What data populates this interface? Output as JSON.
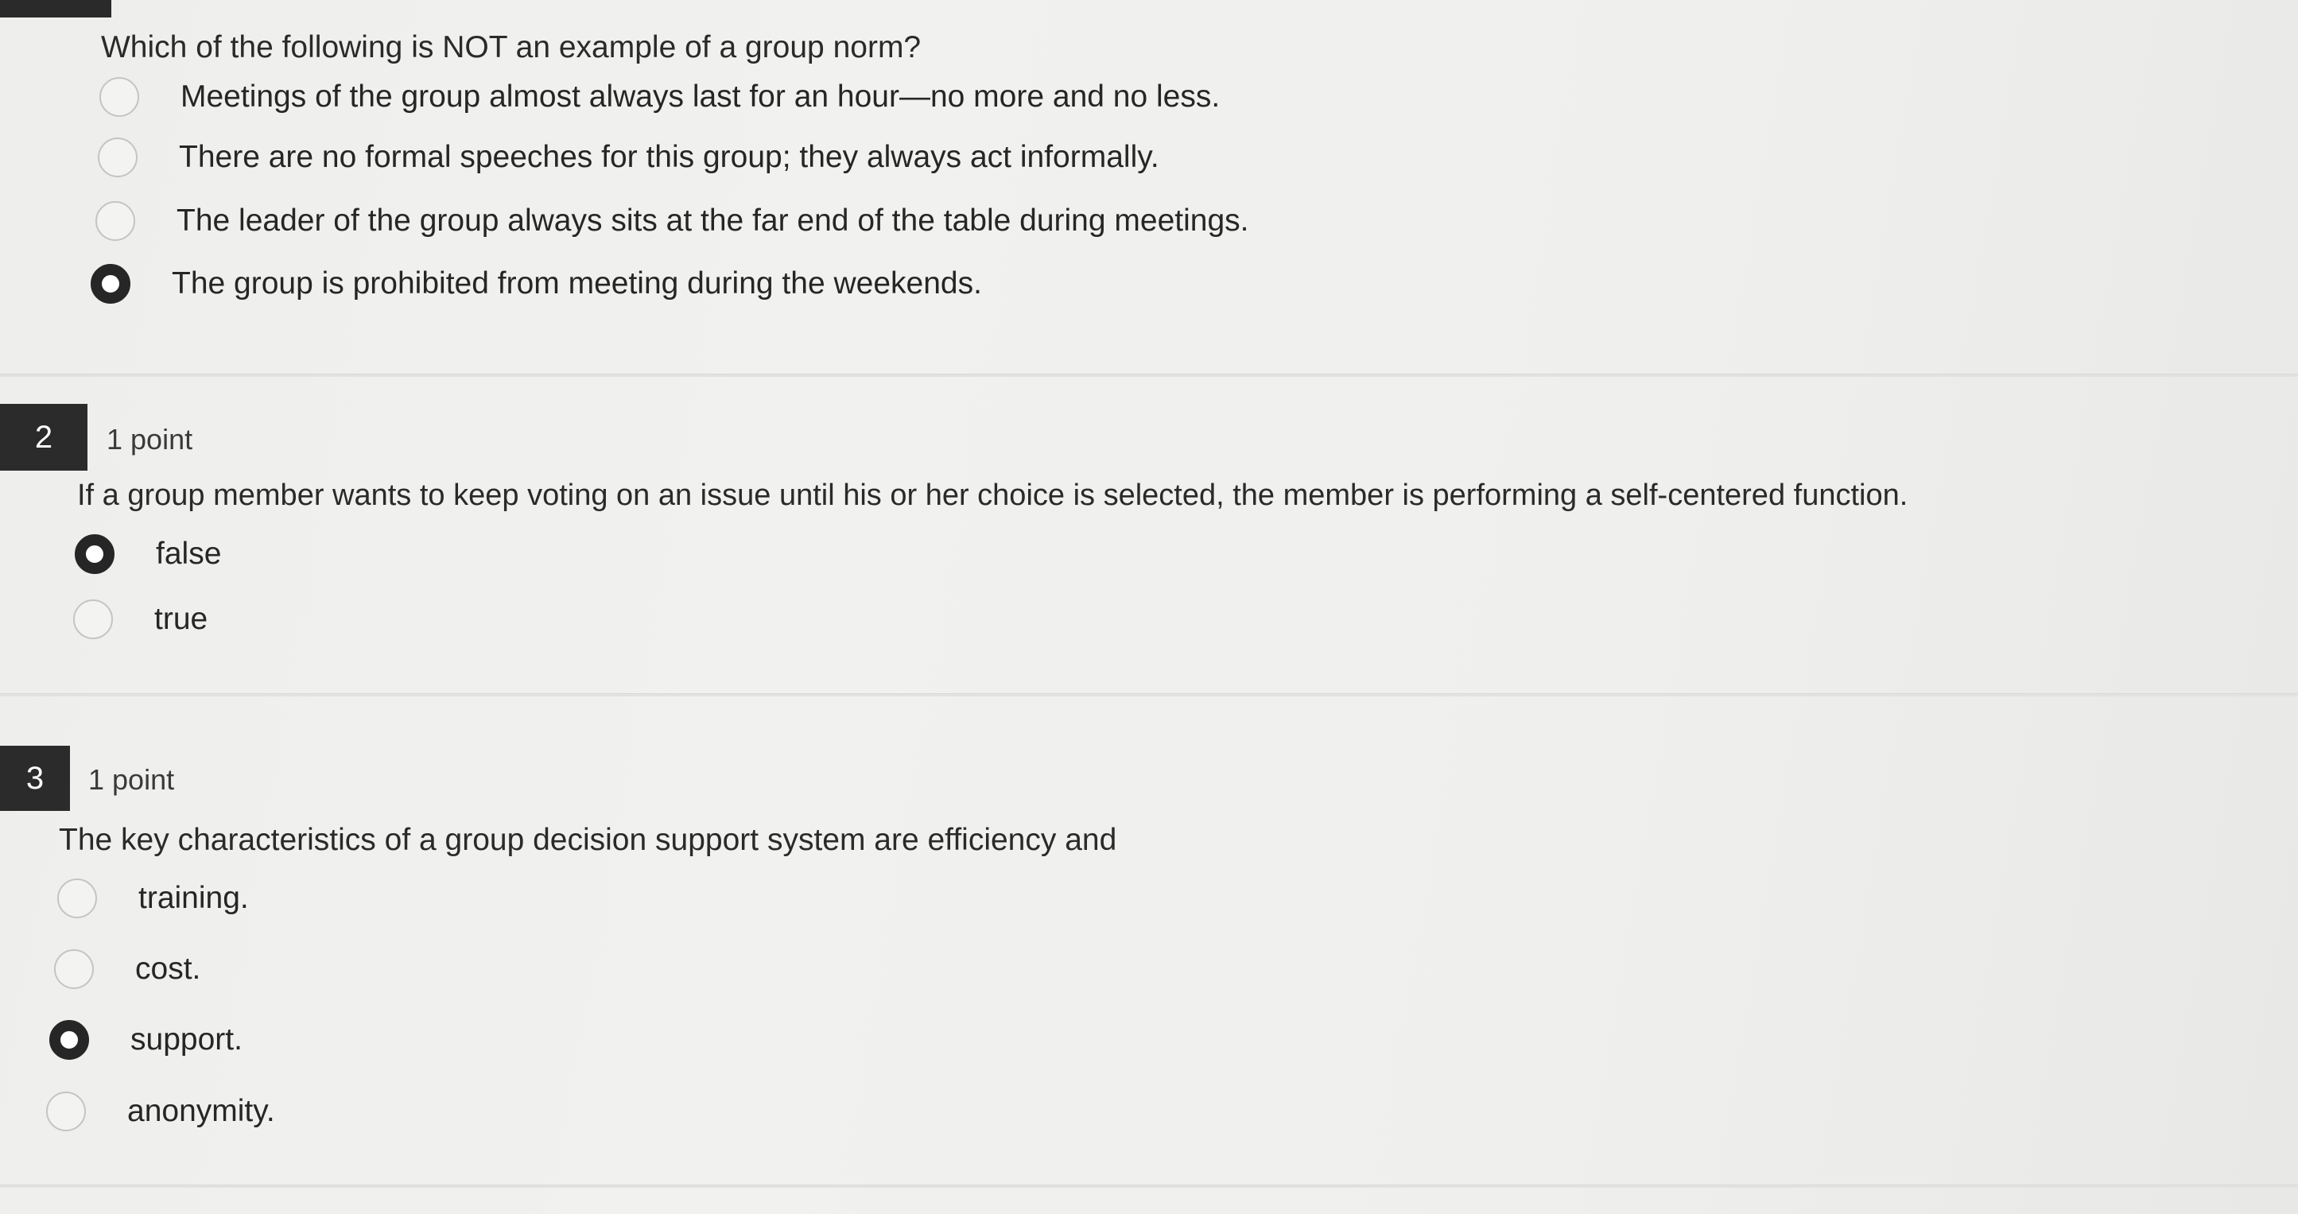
{
  "q1": {
    "text": "Which of the following is NOT an example of a group norm?",
    "options": [
      {
        "label": "Meetings of the group almost always last for an hour—no more and no less.",
        "selected": false
      },
      {
        "label": "There are no formal speeches for this group; they always act informally.",
        "selected": false
      },
      {
        "label": "The leader of the group always sits at the far end of the table during meetings.",
        "selected": false
      },
      {
        "label": "The group is prohibited from meeting during the weekends.",
        "selected": true
      }
    ]
  },
  "q2": {
    "number": "2",
    "points": "1 point",
    "text": "If a group member wants to keep voting on an issue until his or her choice is selected, the member is performing a self-centered function.",
    "options": [
      {
        "label": "false",
        "selected": true
      },
      {
        "label": "true",
        "selected": false
      }
    ]
  },
  "q3": {
    "number": "3",
    "points": "1 point",
    "text": "The key characteristics of a group decision support system are efficiency and",
    "options": [
      {
        "label": "training.",
        "selected": false
      },
      {
        "label": "cost.",
        "selected": false
      },
      {
        "label": "support.",
        "selected": true
      },
      {
        "label": "anonymity.",
        "selected": false
      }
    ]
  }
}
